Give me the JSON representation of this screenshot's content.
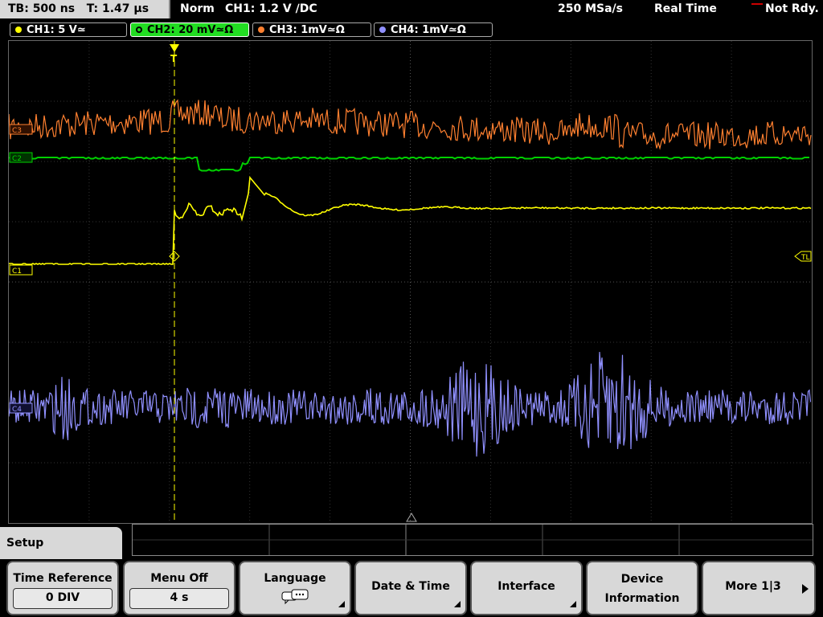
{
  "topbar": {
    "timebase": "TB: 500 ns",
    "trigger_time": "T: 1.47 µs",
    "mode": "Norm",
    "trigger_info": "CH1: 1.2 V ∕DC",
    "sample_rate": "250 MSa/s",
    "acq_mode": "Real Time",
    "status": "Not Rdy."
  },
  "channels": [
    {
      "label": "CH1: 5 V≃",
      "color": "#ffff00",
      "active": false
    },
    {
      "label": "CH2: 20 mV≃Ω",
      "color": "#00d000",
      "active": true
    },
    {
      "label": "CH3: 1mV≃Ω",
      "color": "#ff8030",
      "active": false
    },
    {
      "label": "CH4: 1mV≃Ω",
      "color": "#9090ff",
      "active": false
    }
  ],
  "markers": {
    "trigger_level": "TL",
    "ch1": "C1",
    "ch2": "C2",
    "ch3": "C3",
    "ch4": "C4",
    "trigger_pos": "T"
  },
  "setup": {
    "title": "Setup"
  },
  "softkeys": {
    "time_reference": {
      "label": "Time Reference",
      "value": "0 DIV"
    },
    "menu_off": {
      "label": "Menu Off",
      "value": "4 s"
    },
    "language": {
      "label": "Language"
    },
    "date_time": {
      "label": "Date & Time"
    },
    "interface": {
      "label": "Interface"
    },
    "device_info": {
      "label1": "Device",
      "label2": "Information"
    },
    "more": {
      "label": "More 1|3"
    }
  }
}
